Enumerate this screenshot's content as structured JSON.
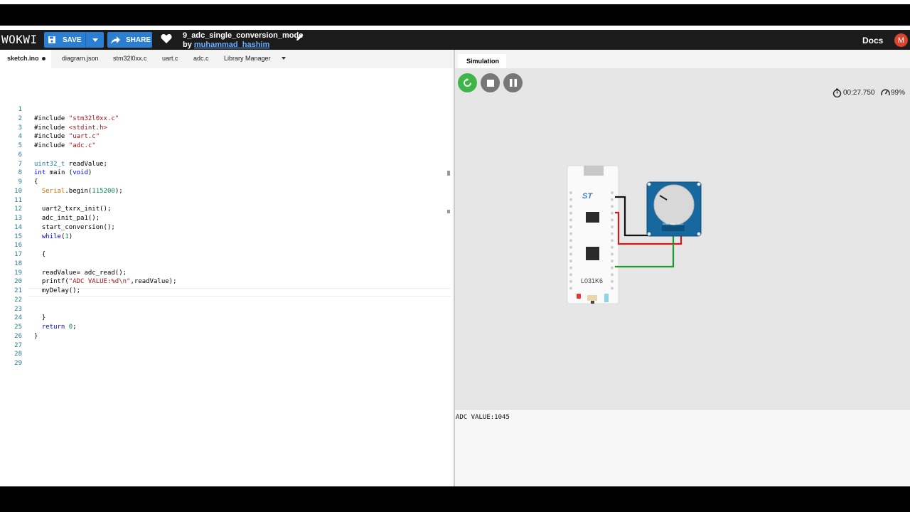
{
  "app": {
    "logo": "WOKWI"
  },
  "toolbar": {
    "save_label": "SAVE",
    "share_label": "SHARE"
  },
  "project": {
    "title": "9_adc_single_conversion_mode",
    "by_prefix": "by ",
    "author": "muhammad_hashim"
  },
  "header": {
    "docs_label": "Docs",
    "avatar_initial": "M"
  },
  "tabs": [
    {
      "label": "sketch.ino"
    },
    {
      "label": "diagram.json"
    },
    {
      "label": "stm32l0xx.c"
    },
    {
      "label": "uart.c"
    },
    {
      "label": "adc.c"
    },
    {
      "label": "Library Manager"
    }
  ],
  "editor": {
    "lines": [
      "",
      "#include \"stm32l0xx.c\"",
      "#include <stdint.h>",
      "#include \"uart.c\"",
      "#include \"adc.c\"",
      "",
      "uint32_t readValue;",
      "int main (void)",
      "{",
      "  Serial.begin(115200);",
      "",
      "  uart2_txrx_init();",
      "  adc_init_pa1();",
      "  start_conversion();",
      "  while(1)",
      "",
      "  {",
      "",
      "  readValue= adc_read();",
      "  printf(\"ADC VALUE:%d\\n\",readValue);",
      "  myDelay();",
      "",
      "",
      "  }",
      "  return 0;",
      "}",
      "",
      "",
      ""
    ]
  },
  "simulation": {
    "tab_label": "Simulation",
    "timer": "00:27.750",
    "speed": "99%",
    "board_label": "L031K6",
    "board_logo": "ST",
    "pot_pins": [
      "GND",
      "SIG",
      "VCC"
    ],
    "wire_colors": {
      "gnd": "#111111",
      "vcc": "#d01a1a",
      "sig": "#1e9a2a"
    }
  },
  "serial_monitor": {
    "output": "ADC VALUE:1045"
  },
  "colors": {
    "accent": "#2a7fd3",
    "run": "#3eb549",
    "topbar": "#1b1b1b"
  }
}
